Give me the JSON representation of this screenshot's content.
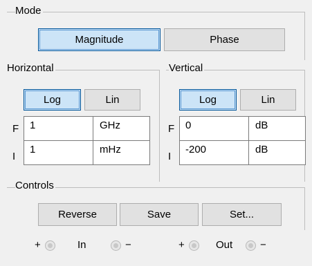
{
  "mode": {
    "title": "Mode",
    "magnitude_label": "Magnitude",
    "phase_label": "Phase",
    "selected": "Magnitude"
  },
  "horizontal": {
    "title": "Horizontal",
    "log_label": "Log",
    "lin_label": "Lin",
    "selected": "Log",
    "f_row": {
      "label": "F",
      "value": "1",
      "unit": "GHz"
    },
    "i_row": {
      "label": "I",
      "value": "1",
      "unit": "mHz"
    }
  },
  "vertical": {
    "title": "Vertical",
    "log_label": "Log",
    "lin_label": "Lin",
    "selected": "Log",
    "f_row": {
      "label": "F",
      "value": "0",
      "unit": "dB"
    },
    "i_row": {
      "label": "I",
      "value": "-200",
      "unit": "dB"
    }
  },
  "controls": {
    "title": "Controls",
    "reverse_label": "Reverse",
    "save_label": "Save",
    "set_label": "Set..."
  },
  "io": {
    "in_label": "In",
    "out_label": "Out",
    "plus_sign": "+",
    "minus_sign": "−"
  },
  "colors": {
    "selected_fill": "#cce4f7",
    "selected_border": "#005499",
    "button_fill": "#e1e1e1"
  }
}
